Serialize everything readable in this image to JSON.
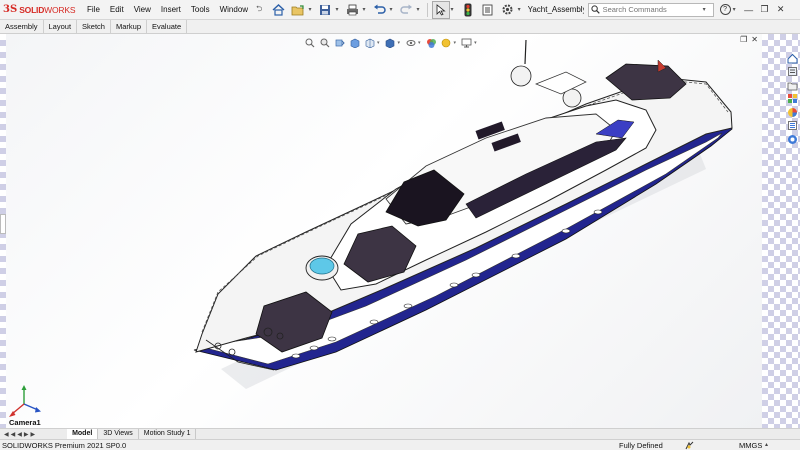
{
  "app": {
    "logo_prefix": "3S",
    "logo_bold": "SOLID",
    "logo_light": "WORKS",
    "document_title": "Yacht_Assembly..."
  },
  "menu": [
    "File",
    "Edit",
    "View",
    "Insert",
    "Tools",
    "Window"
  ],
  "search": {
    "placeholder": "Search Commands"
  },
  "command_tabs": [
    "Assembly",
    "Layout",
    "Sketch",
    "Markup",
    "Evaluate"
  ],
  "bottom_tabs": [
    {
      "label": "Model",
      "active": true
    },
    {
      "label": "3D Views",
      "active": false
    },
    {
      "label": "Motion Study 1",
      "active": false
    }
  ],
  "viewport": {
    "view_label": "Camera1"
  },
  "status": {
    "product": "SOLIDWORKS Premium 2021 SP0.0",
    "state": "Fully Defined",
    "units": "MMGS"
  },
  "colors": {
    "accent_red": "#d62a24",
    "hull_blue": "#22258f",
    "deck_dark": "#3d3444",
    "checker": "#cfcfe6"
  },
  "icons": {
    "toolbar": [
      "home-icon",
      "open-icon",
      "save-icon",
      "print-icon",
      "undo-icon",
      "redo-icon",
      "select-icon",
      "traffic-light-icon",
      "file-properties-icon",
      "options-icon"
    ],
    "heads_up": [
      "zoom-to-fit-icon",
      "zoom-area-icon",
      "previous-view-icon",
      "section-view-icon",
      "view-orientation-icon",
      "display-style-icon",
      "hide-show-icon",
      "edit-appearance-icon",
      "scene-icon",
      "view-settings-icon",
      "display-icon"
    ],
    "task_pane": [
      "solidworks-resources-icon",
      "design-library-icon",
      "file-explorer-icon",
      "view-palette-icon",
      "appearances-icon",
      "custom-properties-icon",
      "forum-icon"
    ]
  }
}
